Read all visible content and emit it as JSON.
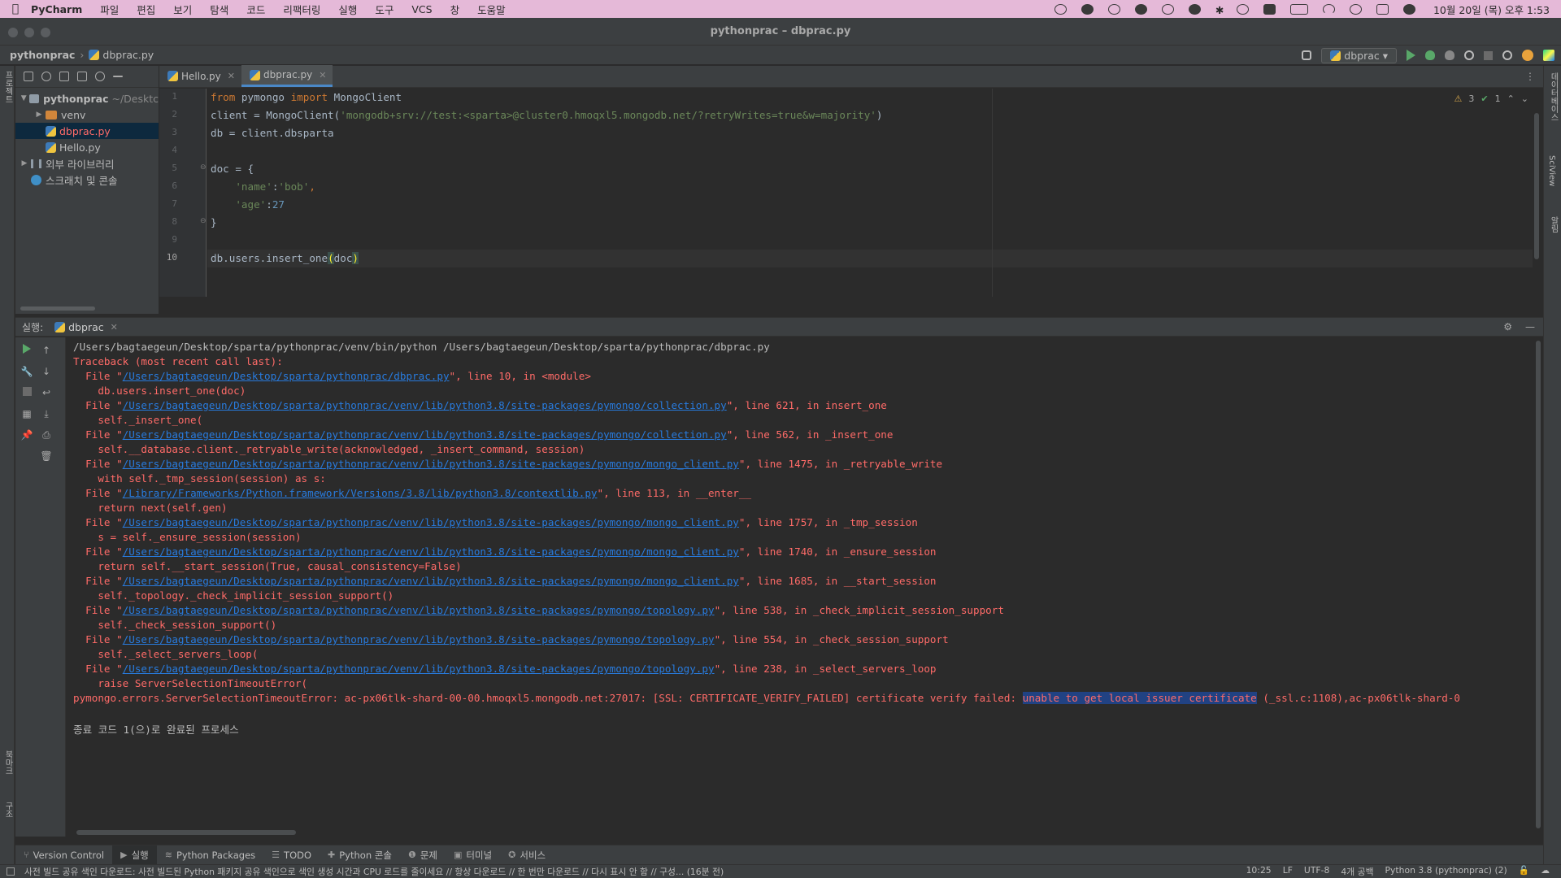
{
  "menubar": {
    "app": "PyCharm",
    "items": [
      "파일",
      "편집",
      "보기",
      "탐색",
      "코드",
      "리팩터링",
      "실행",
      "도구",
      "VCS",
      "창",
      "도움말"
    ],
    "clock": "10월 20일 (목) 오후 1:53"
  },
  "window": {
    "title": "pythonprac – dbprac.py"
  },
  "navbar": {
    "project": "pythonprac",
    "file": "dbprac.py",
    "run_config": "dbprac"
  },
  "project_panel": {
    "root_name": "pythonprac",
    "root_path": "~/Desktc",
    "items": [
      {
        "label": "venv"
      },
      {
        "label": "dbprac.py"
      },
      {
        "label": "Hello.py"
      },
      {
        "label": "외부 라이브러리"
      },
      {
        "label": "스크래치 및 콘솔"
      }
    ]
  },
  "editor": {
    "tabs": [
      {
        "label": "Hello.py"
      },
      {
        "label": "dbprac.py"
      }
    ],
    "line_numbers": [
      "1",
      "2",
      "3",
      "4",
      "5",
      "6",
      "7",
      "8",
      "9",
      "10"
    ],
    "inspections": {
      "warnings": "3",
      "ok": "1"
    },
    "code": {
      "l1_from": "from",
      "l1_mod": " pymongo ",
      "l1_import": "import",
      "l1_name": " MongoClient",
      "l2_pre": "client = MongoClient(",
      "l2_str": "'mongodb+srv://test:<sparta>@cluster0.hmoqxl5.mongodb.net/?retryWrites=true&w=majority'",
      "l2_post": ")",
      "l3": "db = client.dbsparta",
      "l5": "doc = {",
      "l6_key": "    'name'",
      "l6_colon": ":",
      "l6_val": "'bob'",
      "l6_comma": ",",
      "l7_key": "    'age'",
      "l7_colon": ":",
      "l7_val": "27",
      "l8": "}",
      "l10_pre": "db.users.insert_one",
      "l10_open": "(",
      "l10_arg": "doc",
      "l10_close": ")"
    }
  },
  "run_panel": {
    "label": "실행:",
    "tab": "dbprac"
  },
  "console": {
    "command": "/Users/bagtaegeun/Desktop/sparta/pythonprac/venv/bin/python /Users/bagtaegeun/Desktop/sparta/pythonprac/dbprac.py",
    "traceback_header": "Traceback (most recent call last):",
    "frames": [
      {
        "path": "/Users/bagtaegeun/Desktop/sparta/pythonprac/dbprac.py",
        "loc": "\", line 10, in <module>",
        "code": "    db.users.insert_one(doc)"
      },
      {
        "path": "/Users/bagtaegeun/Desktop/sparta/pythonprac/venv/lib/python3.8/site-packages/pymongo/collection.py",
        "loc": "\", line 621, in insert_one",
        "code": "    self._insert_one("
      },
      {
        "path": "/Users/bagtaegeun/Desktop/sparta/pythonprac/venv/lib/python3.8/site-packages/pymongo/collection.py",
        "loc": "\", line 562, in _insert_one",
        "code": "    self.__database.client._retryable_write(acknowledged, _insert_command, session)"
      },
      {
        "path": "/Users/bagtaegeun/Desktop/sparta/pythonprac/venv/lib/python3.8/site-packages/pymongo/mongo_client.py",
        "loc": "\", line 1475, in _retryable_write",
        "code": "    with self._tmp_session(session) as s:"
      },
      {
        "path": "/Library/Frameworks/Python.framework/Versions/3.8/lib/python3.8/contextlib.py",
        "loc": "\", line 113, in __enter__",
        "code": "    return next(self.gen)"
      },
      {
        "path": "/Users/bagtaegeun/Desktop/sparta/pythonprac/venv/lib/python3.8/site-packages/pymongo/mongo_client.py",
        "loc": "\", line 1757, in _tmp_session",
        "code": "    s = self._ensure_session(session)"
      },
      {
        "path": "/Users/bagtaegeun/Desktop/sparta/pythonprac/venv/lib/python3.8/site-packages/pymongo/mongo_client.py",
        "loc": "\", line 1740, in _ensure_session",
        "code": "    return self.__start_session(True, causal_consistency=False)"
      },
      {
        "path": "/Users/bagtaegeun/Desktop/sparta/pythonprac/venv/lib/python3.8/site-packages/pymongo/mongo_client.py",
        "loc": "\", line 1685, in __start_session",
        "code": "    self._topology._check_implicit_session_support()"
      },
      {
        "path": "/Users/bagtaegeun/Desktop/sparta/pythonprac/venv/lib/python3.8/site-packages/pymongo/topology.py",
        "loc": "\", line 538, in _check_implicit_session_support",
        "code": "    self._check_session_support()"
      },
      {
        "path": "/Users/bagtaegeun/Desktop/sparta/pythonprac/venv/lib/python3.8/site-packages/pymongo/topology.py",
        "loc": "\", line 554, in _check_session_support",
        "code": "    self._select_servers_loop("
      },
      {
        "path": "/Users/bagtaegeun/Desktop/sparta/pythonprac/venv/lib/python3.8/site-packages/pymongo/topology.py",
        "loc": "\", line 238, in _select_servers_loop",
        "code": "    raise ServerSelectionTimeoutError("
      }
    ],
    "file_prefix": "  File \"",
    "error_pre": "pymongo.errors.ServerSelectionTimeoutError: ac-px06tlk-shard-00-00.hmoqxl5.mongodb.net:27017: [SSL: CERTIFICATE_VERIFY_FAILED] certificate verify failed: ",
    "error_selected": "unable to get local issuer certificate",
    "error_post": " (_ssl.c:1108),ac-px06tlk-shard-0",
    "exit": "종료 코드 1(으)로 완료된 프로세스"
  },
  "tool_windows": [
    {
      "label": "Version Control",
      "glyph": "⑂"
    },
    {
      "label": "실행",
      "glyph": "▶"
    },
    {
      "label": "Python Packages",
      "glyph": "≋"
    },
    {
      "label": "TODO",
      "glyph": "☰"
    },
    {
      "label": "Python 콘솔",
      "glyph": "✚"
    },
    {
      "label": "문제",
      "glyph": "❶"
    },
    {
      "label": "터미널",
      "glyph": "▣"
    },
    {
      "label": "서비스",
      "glyph": "✪"
    }
  ],
  "status": {
    "message": "사전 빌드 공유 색인 다운로드: 사전 빌드된 Python 패키지 공유 색인으로 색인 생성 시간과 CPU 로드를 줄이세요 // 항상 다운로드 // 한 번만 다운로드 // 다시 표시 안 함 // 구성... (16분 전)",
    "position": "10:25",
    "line_sep": "LF",
    "encoding": "UTF-8",
    "indent": "4개 공백",
    "interpreter": "Python 3.8 (pythonprac) (2)"
  },
  "colors": {
    "menubar_bg": "#e5b9d8",
    "editor_bg": "#2b2b2b",
    "error_red": "#ff6b68",
    "link_blue": "#287bde",
    "keyword": "#cc7832",
    "string": "#6a8759"
  }
}
